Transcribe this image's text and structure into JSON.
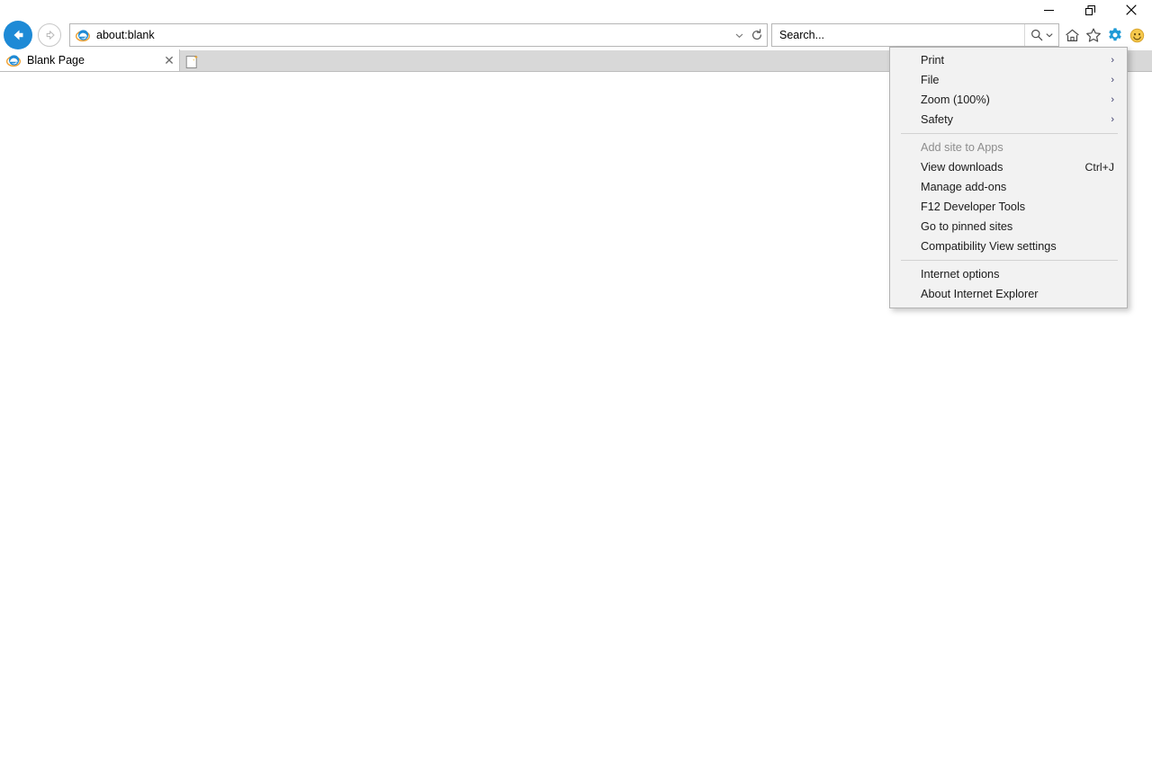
{
  "window": {
    "controls": [
      {
        "name": "minimize",
        "glyph": "—"
      },
      {
        "name": "restore",
        "glyph": "❐"
      },
      {
        "name": "close",
        "glyph": "✕"
      }
    ]
  },
  "navigation": {
    "back_label": "Back",
    "forward_label": "Forward",
    "address": {
      "value": "about:blank",
      "placeholder": "",
      "dropdown_icon": "chevron-down-icon",
      "refresh_icon": "refresh-icon"
    },
    "search": {
      "value": "",
      "placeholder": "Search...",
      "go_icon": "search-icon",
      "dropdown_icon": "chevron-down-icon"
    },
    "tool_icons": [
      {
        "name": "home-icon",
        "label": "Home",
        "active": false
      },
      {
        "name": "favorites-icon",
        "label": "Favorites",
        "active": false
      },
      {
        "name": "gear-icon",
        "label": "Tools",
        "active": true
      },
      {
        "name": "smiley-icon",
        "label": "Send feedback",
        "active": false
      }
    ]
  },
  "tabs": {
    "items": [
      {
        "title": "Blank Page",
        "favicon": "ie-icon",
        "close_glyph": "✕"
      }
    ],
    "new_tab_label": "New tab"
  },
  "menu": {
    "title": "Tools",
    "items": [
      {
        "label": "Print",
        "type": "submenu",
        "accel": "",
        "disabled": false
      },
      {
        "label": "File",
        "type": "submenu",
        "accel": "",
        "disabled": false
      },
      {
        "label": "Zoom (100%)",
        "type": "submenu",
        "accel": "",
        "disabled": false
      },
      {
        "label": "Safety",
        "type": "submenu",
        "accel": "",
        "disabled": false
      },
      {
        "label": "",
        "type": "separator",
        "accel": "",
        "disabled": false
      },
      {
        "label": "Add site to Apps",
        "type": "item",
        "accel": "",
        "disabled": true
      },
      {
        "label": "View downloads",
        "type": "item",
        "accel": "Ctrl+J",
        "disabled": false
      },
      {
        "label": "Manage add-ons",
        "type": "item",
        "accel": "",
        "disabled": false
      },
      {
        "label": "F12 Developer Tools",
        "type": "item",
        "accel": "",
        "disabled": false
      },
      {
        "label": "Go to pinned sites",
        "type": "item",
        "accel": "",
        "disabled": false
      },
      {
        "label": "Compatibility View settings",
        "type": "item",
        "accel": "",
        "disabled": false
      },
      {
        "label": "",
        "type": "separator",
        "accel": "",
        "disabled": false
      },
      {
        "label": "Internet options",
        "type": "item",
        "accel": "",
        "disabled": false
      },
      {
        "label": "About Internet Explorer",
        "type": "item",
        "accel": "",
        "disabled": false
      }
    ],
    "submenu_glyph": "›"
  },
  "colors": {
    "accent_blue": "#1e8ad6",
    "gear_blue": "#1e9ad6",
    "menu_bg": "#f2f2f2",
    "tabstrip_bg": "#d8d8d8",
    "disabled_text": "#8d8d8d",
    "smiley_yellow": "#f2c14b"
  },
  "page": {
    "body_text": ""
  }
}
